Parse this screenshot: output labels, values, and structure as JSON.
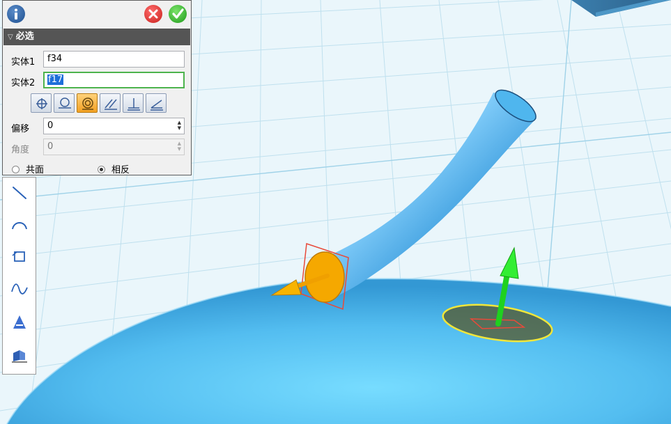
{
  "panel": {
    "section_title": "必选",
    "entity1_label": "实体1",
    "entity1_value": "f34",
    "entity2_label": "实体2",
    "entity2_value": "f17",
    "offset_label": "偏移",
    "offset_value": "0",
    "angle_label": "角度",
    "angle_value": "0",
    "radio_coplanar": "共面",
    "radio_opposite": "相反",
    "selected_radio": "相反",
    "active_constraint": "concentric-icon"
  },
  "icons": {
    "titlebar": [
      "info-icon",
      "cancel-icon",
      "confirm-icon"
    ],
    "constraints": [
      "point-icon",
      "tangent-icon",
      "concentric-icon",
      "parallel-icon",
      "perpendicular-icon",
      "angle-icon"
    ],
    "tools": [
      "line-icon",
      "arc-icon",
      "rectangle-icon",
      "spline-icon",
      "text-icon",
      "plane-icon"
    ]
  },
  "colors": {
    "active_button": "#f2a021",
    "accent_green": "#4db34d",
    "selection": "#1e6fd9",
    "model_blue": "#4fb6ee",
    "arrow_orange": "#f7a800",
    "arrow_green": "#22dd22"
  }
}
